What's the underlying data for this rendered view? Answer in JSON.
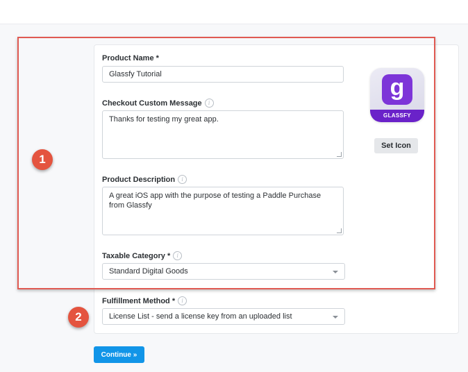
{
  "form": {
    "product_name": {
      "label": "Product Name *",
      "value": "Glassfy Tutorial"
    },
    "checkout_message": {
      "label": "Checkout Custom Message",
      "value": "Thanks for testing my great app."
    },
    "product_description": {
      "label": "Product Description",
      "value": "A great iOS app with the purpose of testing a Paddle Purchase from Glassfy"
    },
    "taxable_category": {
      "label": "Taxable Category *",
      "value": "Standard Digital Goods"
    },
    "fulfillment_method": {
      "label": "Fulfillment Method *",
      "value": "License List - send a license key from an uploaded list"
    }
  },
  "icon_panel": {
    "app_icon_letter": "g",
    "app_icon_brand": "GLASSFY",
    "set_icon_label": "Set Icon"
  },
  "annotations": {
    "badge_1": "1",
    "badge_2": "2"
  },
  "actions": {
    "continue_label": "Continue »"
  },
  "info_glyph": "i",
  "colors": {
    "highlight_border": "#e05a52",
    "badge": "#e4543f",
    "primary_button": "#1195e8",
    "app_icon_purple": "#7d35d8"
  },
  "icons": [
    "info-icon",
    "glassfy-app-icon",
    "chevron-down-icon",
    "resize-grip-icon"
  ]
}
